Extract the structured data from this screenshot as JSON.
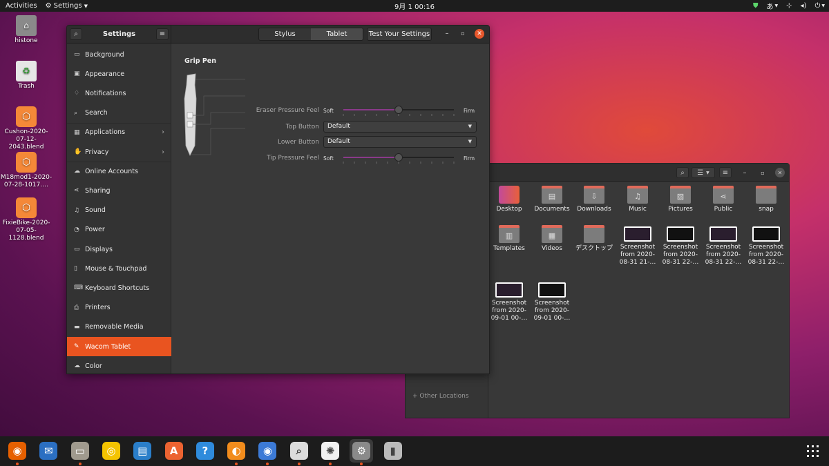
{
  "topbar": {
    "activities": "Activities",
    "app_menu": "Settings",
    "clock": "9月 1  00:16",
    "ime": "あ"
  },
  "desktop": [
    {
      "label": "histone",
      "kind": "folder"
    },
    {
      "label": "Trash",
      "kind": "trash"
    },
    {
      "label": "Cushon-2020-07-12-2043.blend",
      "kind": "blend"
    },
    {
      "label": "M18mod1-2020-07-28-1017.…",
      "kind": "blend"
    },
    {
      "label": "FixieBike-2020-07-05-1128.blend",
      "kind": "blend"
    }
  ],
  "settings": {
    "title": "Settings",
    "tabs": [
      {
        "label": "Stylus",
        "active": false
      },
      {
        "label": "Tablet",
        "active": true
      }
    ],
    "test_button": "Test Your Settings",
    "nav": [
      {
        "label": "Background",
        "icon": "background-icon",
        "glyph": "▭"
      },
      {
        "label": "Appearance",
        "icon": "appearance-icon",
        "glyph": "▣"
      },
      {
        "label": "Notifications",
        "icon": "bell-icon",
        "glyph": "♢"
      },
      {
        "label": "Search",
        "icon": "search-icon",
        "glyph": "⌕"
      },
      {
        "label": "Applications",
        "icon": "applications-icon",
        "glyph": "▦",
        "chevron": true
      },
      {
        "label": "Privacy",
        "icon": "hand-icon",
        "glyph": "✋",
        "chevron": true
      },
      {
        "label": "Online Accounts",
        "icon": "cloud-icon",
        "glyph": "☁"
      },
      {
        "label": "Sharing",
        "icon": "share-icon",
        "glyph": "⋖"
      },
      {
        "label": "Sound",
        "icon": "music-note-icon",
        "glyph": "♫"
      },
      {
        "label": "Power",
        "icon": "power-icon",
        "glyph": "◔"
      },
      {
        "label": "Displays",
        "icon": "display-icon",
        "glyph": "▭"
      },
      {
        "label": "Mouse & Touchpad",
        "icon": "mouse-icon",
        "glyph": "▯"
      },
      {
        "label": "Keyboard Shortcuts",
        "icon": "keyboard-icon",
        "glyph": "⌨"
      },
      {
        "label": "Printers",
        "icon": "printer-icon",
        "glyph": "⎙"
      },
      {
        "label": "Removable Media",
        "icon": "usb-drive-icon",
        "glyph": "▬"
      },
      {
        "label": "Wacom Tablet",
        "icon": "tablet-icon",
        "glyph": "✎",
        "active": true
      },
      {
        "label": "Color",
        "icon": "color-icon",
        "glyph": "☁"
      }
    ],
    "stylus": {
      "name": "Grip Pen",
      "eraser_label": "Eraser Pressure Feel",
      "eraser_level": 0.5,
      "top_label": "Top Button",
      "top_value": "Default",
      "lower_label": "Lower Button",
      "lower_value": "Default",
      "tip_label": "Tip Pressure Feel",
      "tip_level": 0.5,
      "soft": "Soft",
      "firm": "Firm"
    }
  },
  "files": {
    "items": [
      {
        "label": "Desktop",
        "kind": "desk"
      },
      {
        "label": "Documents",
        "kind": "fold",
        "glyph": "▤"
      },
      {
        "label": "Downloads",
        "kind": "fold",
        "glyph": "⇩"
      },
      {
        "label": "Music",
        "kind": "fold",
        "glyph": "♫"
      },
      {
        "label": "Pictures",
        "kind": "fold",
        "glyph": "▨"
      },
      {
        "label": "Public",
        "kind": "fold",
        "glyph": "⋖"
      },
      {
        "label": "snap",
        "kind": "fold",
        "glyph": ""
      },
      {
        "label": "Templates",
        "kind": "fold",
        "glyph": "▥"
      },
      {
        "label": "Videos",
        "kind": "fold",
        "glyph": "▦"
      },
      {
        "label": "デスクトップ",
        "kind": "fold",
        "glyph": ""
      },
      {
        "label": "Screenshot from 2020-08-31 21-…",
        "kind": "shot"
      },
      {
        "label": "Screenshot from 2020-08-31 22-…",
        "kind": "shot"
      },
      {
        "label": "Screenshot from 2020-08-31 22-…",
        "kind": "shot"
      },
      {
        "label": "Screenshot from 2020-08-31 22-…",
        "kind": "shot"
      },
      {
        "label": "Screenshot from 2020-09-01 00-…",
        "kind": "shot"
      },
      {
        "label": "Screenshot from 2020-09-01 00-…",
        "kind": "shot"
      }
    ],
    "other_locations": "+  Other Locations"
  },
  "dock": [
    {
      "name": "firefox-icon",
      "color": "#e66000",
      "glyph": "◉",
      "running": true
    },
    {
      "name": "thunderbird-icon",
      "color": "#2b6fc2",
      "glyph": "✉",
      "running": false
    },
    {
      "name": "files-icon",
      "color": "#a09a8e",
      "glyph": "▭",
      "running": true
    },
    {
      "name": "rhythmbox-icon",
      "color": "#f4c400",
      "glyph": "◎",
      "running": false
    },
    {
      "name": "writer-icon",
      "color": "#2a7ec9",
      "glyph": "▤",
      "running": false
    },
    {
      "name": "software-icon",
      "color": "#ec6331",
      "glyph": "A",
      "running": false
    },
    {
      "name": "help-icon",
      "color": "#2f8bdc",
      "glyph": "?",
      "running": false
    },
    {
      "name": "blender-icon",
      "color": "#f28c1c",
      "glyph": "◐",
      "running": true
    },
    {
      "name": "chromium-icon",
      "color": "#3c7ad6",
      "glyph": "◉",
      "running": true
    },
    {
      "name": "screenshot-icon",
      "color": "#dcdcdc",
      "glyph": "⌕",
      "running": true
    },
    {
      "name": "gimp-icon",
      "color": "#f0f0f0",
      "glyph": "✺",
      "running": true
    },
    {
      "name": "settings-gear-icon",
      "color": "#8a8a8a",
      "glyph": "⚙",
      "running": true
    },
    {
      "name": "usb-icon",
      "color": "#bbbbbb",
      "glyph": "▮",
      "running": false
    }
  ]
}
